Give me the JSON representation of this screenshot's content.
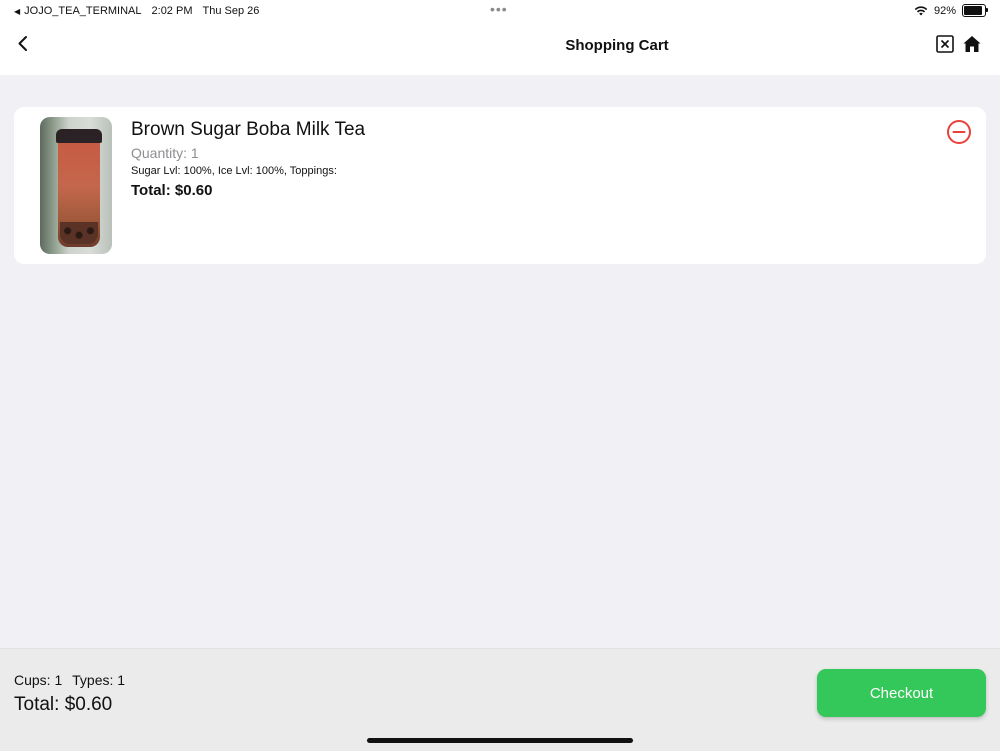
{
  "status_bar": {
    "back_app": "JOJO_TEA_TERMINAL",
    "time": "2:02 PM",
    "date": "Thu Sep 26",
    "battery_percent": "92%",
    "battery_level": 0.92
  },
  "nav": {
    "title": "Shopping Cart",
    "back_icon": "chevron-left-icon",
    "close_icon": "close-square-icon",
    "home_icon": "home-icon"
  },
  "cart": {
    "items": [
      {
        "name": "Brown Sugar Boba Milk Tea",
        "quantity": "Quantity: 1",
        "options": "Sugar Lvl: 100%, Ice Lvl: 100%, Toppings:",
        "total": "Total: $0.60",
        "remove_icon": "minus-circle-icon"
      }
    ]
  },
  "summary": {
    "cups": "Cups: 1",
    "types": "Types: 1",
    "total": "Total: $0.60",
    "checkout_label": "Checkout"
  },
  "colors": {
    "accent_green": "#34c759",
    "remove_red": "#e8413c",
    "background": "#f0f0f5"
  }
}
